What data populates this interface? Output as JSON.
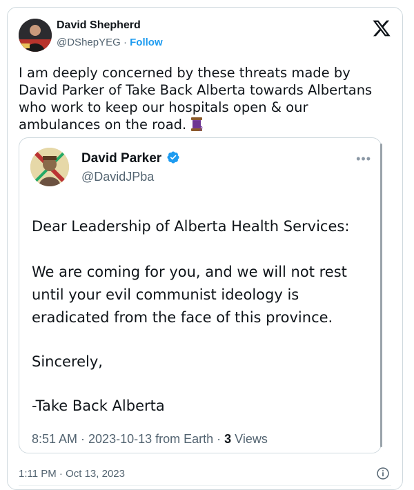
{
  "tweet": {
    "author_name": "David Shepherd",
    "author_handle": "@DShepYEG",
    "separator": "·",
    "follow_label": "Follow",
    "text": "I am deeply concerned by these threats made by David Parker of Take Back Alberta towards Albertans who work to keep our hospitals open & our ambulances on the road.",
    "emoji": "spool-of-thread-icon",
    "timestamp": "1:11 PM · Oct 13, 2023"
  },
  "quoted": {
    "author_name": "David Parker",
    "author_handle": "@DavidJPba",
    "verified_color": "#1d9bf0",
    "more_label": "•••",
    "lines": {
      "salutation": "Dear Leadership of Alberta Health Services:",
      "body": "We are coming for you, and we will not rest until your evil communist ideology is eradicated from the face of this province.",
      "closing": "Sincerely,",
      "signature": "-Take Back Alberta"
    },
    "meta_time": "8:51 AM · 2023-10-13 from Earth · ",
    "views_count": "3",
    "views_label": " Views"
  },
  "colors": {
    "text": "#0f1419",
    "secondary": "#536471",
    "link": "#1d9bf0",
    "border": "#cfd9de"
  }
}
